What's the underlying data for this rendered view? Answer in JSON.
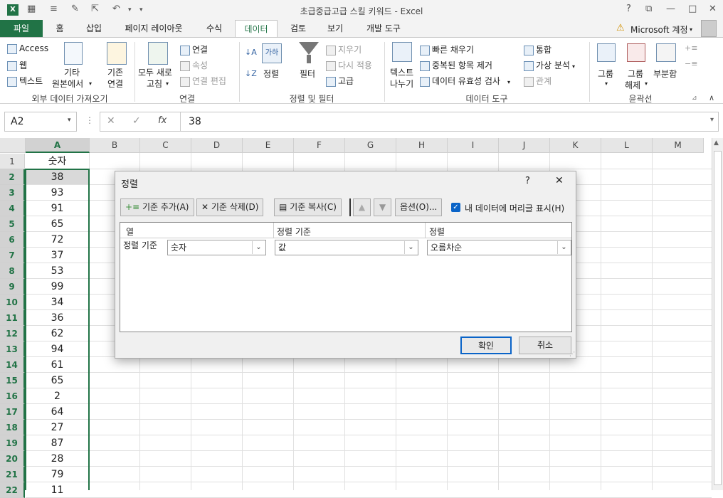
{
  "app": {
    "title": "초급중급고급 스킬 키워드 - Excel",
    "help": "?",
    "account": "Microsoft 계정",
    "minimize": "—",
    "restore": "□",
    "close": "✕",
    "restore_ribbon": "⧉",
    "undo": "↶",
    "qa_more": "▾"
  },
  "tabs": [
    {
      "label": "파일"
    },
    {
      "label": "홈"
    },
    {
      "label": "삽입"
    },
    {
      "label": "페이지 레이아웃"
    },
    {
      "label": "수식"
    },
    {
      "label": "데이터"
    },
    {
      "label": "검토"
    },
    {
      "label": "보기"
    },
    {
      "label": "개발 도구"
    }
  ],
  "ribbon": {
    "access": "Access",
    "web": "웹",
    "text": "텍스트",
    "other_source_1": "기타",
    "other_source_2": "원본에서",
    "existing_1": "기존",
    "existing_2": "연결",
    "refresh_all_1": "모두 새로",
    "refresh_all_2": "고침",
    "connections": "연결",
    "properties": "속성",
    "edit_links": "연결 편집",
    "sort_btn": "정렬",
    "filter": "필터",
    "clear": "지우기",
    "reapply": "다시 적용",
    "advanced": "고급",
    "text_to_columns_1": "텍스트",
    "text_to_columns_2": "나누기",
    "flash_fill": "빠른 채우기",
    "remove_duplicates": "중복된 항목 제거",
    "data_validation": "데이터 유효성 검사",
    "consolidate": "통합",
    "what_if": "가상 분석",
    "relationships": "관계",
    "group": "그룹",
    "ungroup_1": "그룹",
    "ungroup_2": "해제",
    "subtotal": "부분합",
    "group_labels": {
      "external": "외부 데이터 가져오기",
      "connections": "연결",
      "sort_filter": "정렬 및 필터",
      "data_tools": "데이터 도구",
      "outline": "윤곽선"
    }
  },
  "formula": {
    "name_box": "A2",
    "fx": "fx",
    "cancel": "✕",
    "enter": "✓",
    "value": "38"
  },
  "sheet": {
    "columns": [
      "A",
      "B",
      "C",
      "D",
      "E",
      "F",
      "G",
      "H",
      "I",
      "J",
      "K",
      "L",
      "M"
    ],
    "rows": [
      "1",
      "2",
      "3",
      "4",
      "5",
      "6",
      "7",
      "8",
      "9",
      "10",
      "11",
      "12",
      "13",
      "14",
      "15",
      "16",
      "17",
      "18",
      "19",
      "20",
      "21",
      "22"
    ],
    "col_a": [
      "숫자",
      "38",
      "93",
      "91",
      "65",
      "72",
      "37",
      "53",
      "99",
      "34",
      "36",
      "62",
      "94",
      "61",
      "65",
      "2",
      "64",
      "27",
      "87",
      "28",
      "79",
      "11"
    ]
  },
  "dialog": {
    "title": "정렬",
    "help": "?",
    "close": "✕",
    "add_level": "기준 추가(A)",
    "delete_level": "기준 삭제(D)",
    "copy_level": "기준 복사(C)",
    "options": "옵션(O)...",
    "header_checkbox": "내 데이터에 머리글 표시(H)",
    "header_checked": true,
    "col_header_column": "열",
    "col_header_sorton": "정렬 기준",
    "col_header_order": "정렬",
    "row_label": "정렬 기준",
    "column_value": "숫자",
    "sorton_value": "값",
    "order_value": "오름차순",
    "ok": "확인",
    "cancel": "취소"
  }
}
